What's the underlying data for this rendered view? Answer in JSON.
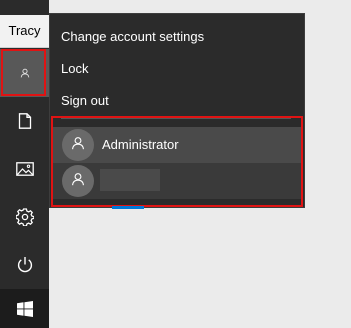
{
  "rail": {
    "tooltip": "Tracy",
    "items": [
      {
        "name": "user"
      },
      {
        "name": "documents"
      },
      {
        "name": "pictures"
      },
      {
        "name": "settings"
      },
      {
        "name": "power"
      },
      {
        "name": "start"
      }
    ]
  },
  "flyout": {
    "menu": [
      {
        "label": "Change account settings"
      },
      {
        "label": "Lock"
      },
      {
        "label": "Sign out"
      }
    ],
    "users": [
      {
        "name": "Administrator"
      },
      {
        "name": ""
      }
    ]
  },
  "colors": {
    "rail_bg": "#2b2b2b",
    "flyout_bg": "#2b2b2b",
    "highlight_red": "#e01313",
    "accent_blue": "#0078d7",
    "desktop_bg": "#ebebeb"
  },
  "icons": [
    "person-icon",
    "document-icon",
    "picture-icon",
    "gear-icon",
    "power-icon",
    "windows-logo-icon"
  ]
}
